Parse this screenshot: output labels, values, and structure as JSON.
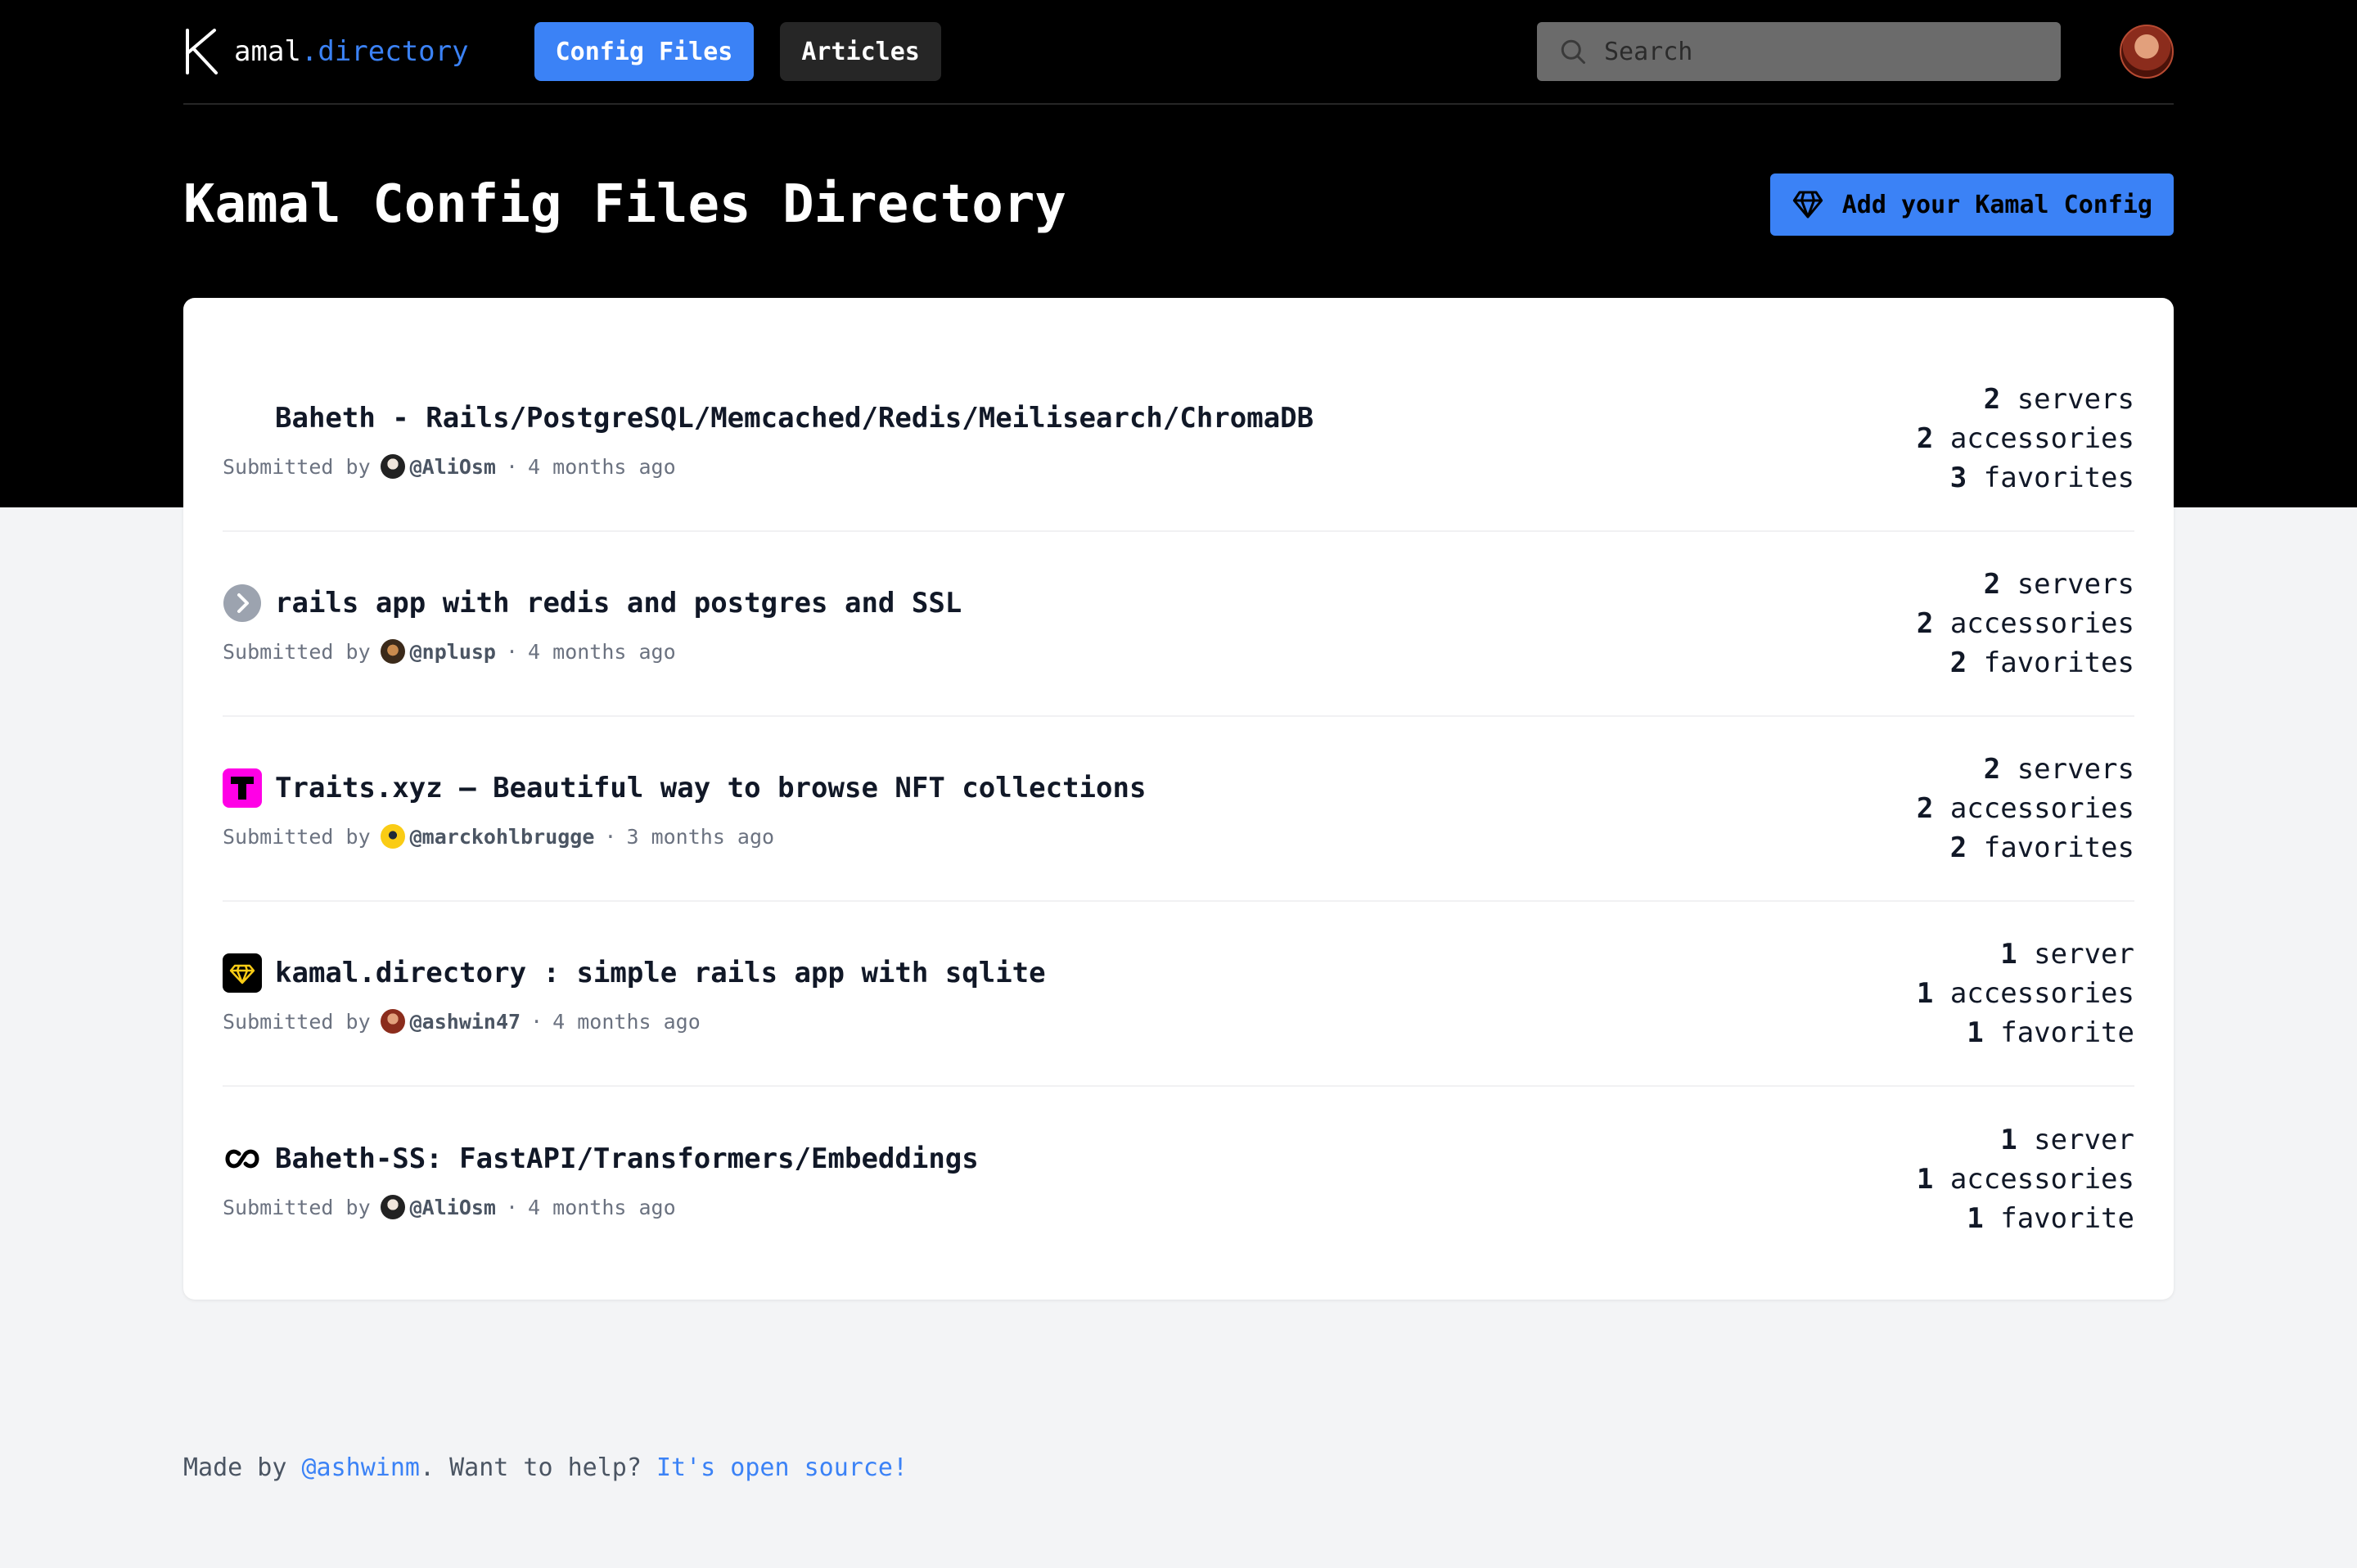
{
  "nav": {
    "logo_main": "amal",
    "logo_accent": ".directory",
    "links": [
      {
        "label": "Config Files",
        "active": true
      },
      {
        "label": "Articles",
        "active": false
      }
    ],
    "search_placeholder": "Search"
  },
  "header": {
    "title": "Kamal Config Files Directory",
    "add_button": "Add your Kamal Config"
  },
  "configs": [
    {
      "title": "Baheth - Rails/PostgreSQL/Memcached/Redis/Meilisearch/ChromaDB",
      "icon": "none",
      "submitted_label": "Submitted by",
      "user": "@AliOsm",
      "time": "4 months ago",
      "servers_count": "2",
      "servers_label": "servers",
      "accessories_count": "2",
      "accessories_label": "accessories",
      "favorites_count": "3",
      "favorites_label": "favorites"
    },
    {
      "title": "rails app with redis and postgres and SSL",
      "icon": "chevron-right-circle-icon",
      "submitted_label": "Submitted by",
      "user": "@nplusp",
      "time": "4 months ago",
      "servers_count": "2",
      "servers_label": "servers",
      "accessories_count": "2",
      "accessories_label": "accessories",
      "favorites_count": "2",
      "favorites_label": "favorites"
    },
    {
      "title": "Traits.xyz – Beautiful way to browse NFT collections",
      "icon": "traits-logo-icon",
      "submitted_label": "Submitted by",
      "user": "@marckohlbrugge",
      "time": "3 months ago",
      "servers_count": "2",
      "servers_label": "servers",
      "accessories_count": "2",
      "accessories_label": "accessories",
      "favorites_count": "2",
      "favorites_label": "favorites"
    },
    {
      "title": "kamal.directory : simple rails app with sqlite",
      "icon": "gem-icon",
      "submitted_label": "Submitted by",
      "user": "@ashwin47",
      "time": "4 months ago",
      "servers_count": "1",
      "servers_label": "server",
      "accessories_count": "1",
      "accessories_label": "accessories",
      "favorites_count": "1",
      "favorites_label": "favorite"
    },
    {
      "title": "Baheth-SS: FastAPI/Transformers/Embeddings",
      "icon": "chain-link-icon",
      "submitted_label": "Submitted by",
      "user": "@AliOsm",
      "time": "4 months ago",
      "servers_count": "1",
      "servers_label": "server",
      "accessories_count": "1",
      "accessories_label": "accessories",
      "favorites_count": "1",
      "favorites_label": "favorite"
    }
  ],
  "footer": {
    "made_by": "Made by ",
    "author": "@ashwinm",
    "help": ". Want to help? ",
    "open_source": "It's open source!"
  },
  "colors": {
    "accent": "#3b82f6",
    "hero_bg": "#000000",
    "page_bg": "#f3f4f6",
    "traits_magenta": "#ff00e6"
  }
}
